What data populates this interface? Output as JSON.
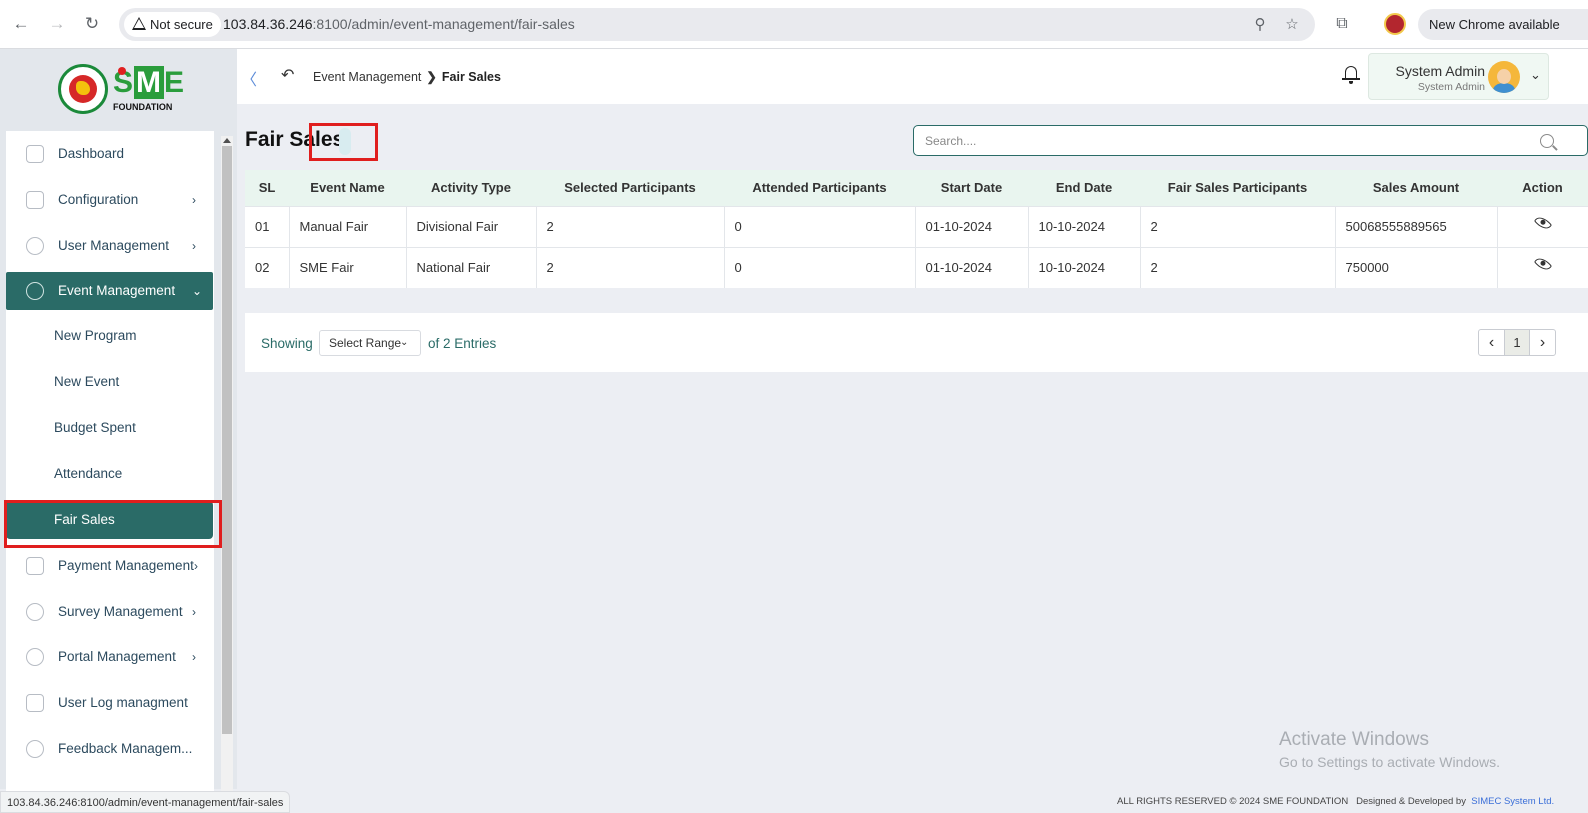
{
  "browser": {
    "security_label": "Not secure",
    "url_host": "103.84.36.246",
    "url_rest": ":8100/admin/event-management/fair-sales",
    "new_chrome_label": "New Chrome available",
    "status_url": "103.84.36.246:8100/admin/event-management/fair-sales"
  },
  "brand": {
    "s": "S",
    "m": "M",
    "e": "E",
    "foundation": "FOUNDATION"
  },
  "sidebar": {
    "items": [
      {
        "label": "Dashboard",
        "icon": "grid-icon",
        "has_chevron": false
      },
      {
        "label": "Configuration",
        "icon": "nodes-icon",
        "has_chevron": true
      },
      {
        "label": "User Management",
        "icon": "shield-user-icon",
        "has_chevron": true
      },
      {
        "label": "Event Management",
        "icon": "lock-circle-icon",
        "has_chevron": true,
        "expanded": true
      },
      {
        "label": "Payment Management",
        "icon": "cash-icon",
        "has_chevron": true
      },
      {
        "label": "Survey Management",
        "icon": "pie-icon",
        "has_chevron": true
      },
      {
        "label": "Portal Management",
        "icon": "lock-circle-icon",
        "has_chevron": true
      },
      {
        "label": "User Log managment",
        "icon": "cash-icon",
        "has_chevron": false
      },
      {
        "label": "Feedback Managem...",
        "icon": "feedback-icon",
        "has_chevron": false
      }
    ],
    "sub_items": [
      {
        "label": "New Program"
      },
      {
        "label": "New Event"
      },
      {
        "label": "Budget Spent"
      },
      {
        "label": "Attendance"
      },
      {
        "label": "Fair Sales",
        "active": true
      }
    ]
  },
  "topbar": {
    "breadcrumb_parent": "Event Management",
    "breadcrumb_sep": "❯",
    "breadcrumb_current": "Fair Sales",
    "user_name": "System Admin",
    "user_role": "System Admin"
  },
  "main": {
    "title": "Fair Sales",
    "search_placeholder": "Search....",
    "table": {
      "headers": [
        "SL",
        "Event Name",
        "Activity Type",
        "Selected Participants",
        "Attended Participants",
        "Start Date",
        "End Date",
        "Fair Sales Participants",
        "Sales Amount",
        "Action"
      ],
      "rows": [
        [
          "01",
          "Manual Fair",
          "Divisional Fair",
          "2",
          "0",
          "01-10-2024",
          "10-10-2024",
          "2",
          "50068555889565"
        ],
        [
          "02",
          "SME Fair",
          "National Fair",
          "2",
          "0",
          "01-10-2024",
          "10-10-2024",
          "2",
          "750000"
        ]
      ]
    },
    "pagination": {
      "showing_label": "Showing",
      "range_select": "Select Range",
      "entries_label": "of 2 Entries",
      "current_page": "1"
    }
  },
  "overlay": {
    "activate_title": "Activate Windows",
    "activate_sub": "Go to Settings to activate Windows."
  },
  "footer": {
    "copyright": "ALL RIGHTS RESERVED © 2024 SME FOUNDATION",
    "designed_by": "Designed & Developed by",
    "company": "SIMEC System Ltd."
  },
  "colors": {
    "accent": "#2a6b67",
    "highlight": "#e01e1e",
    "header_bg": "#e9f5ef"
  }
}
